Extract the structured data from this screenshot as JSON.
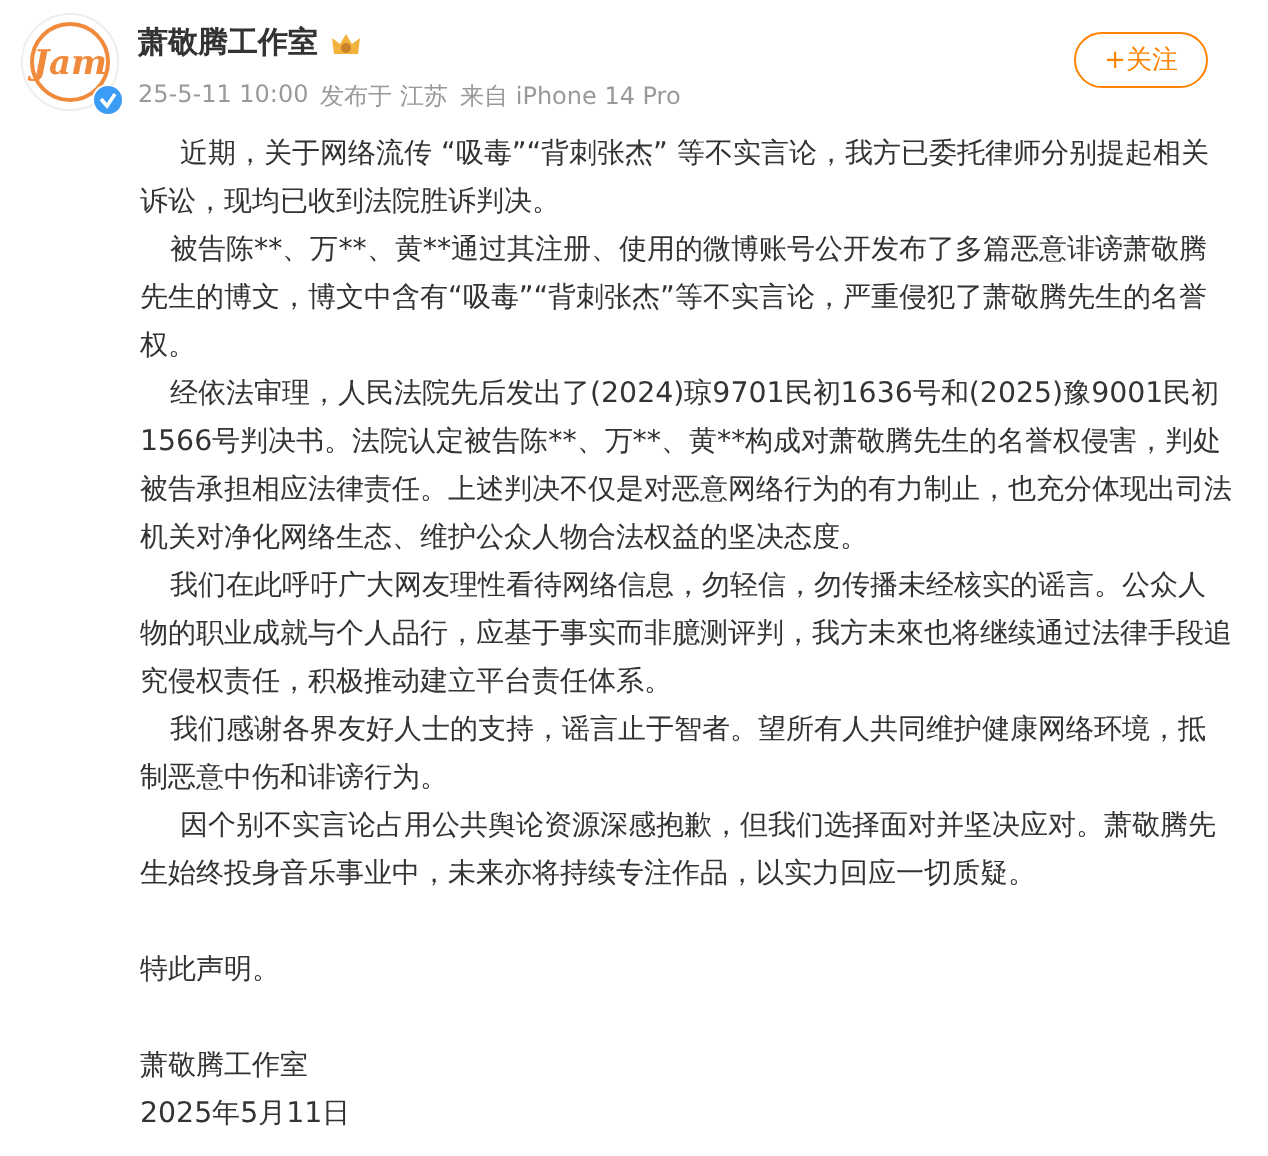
{
  "post": {
    "avatar": {
      "logo_text": "Jam",
      "verified": true
    },
    "author": "萧敬腾工作室",
    "meta": [
      "25-5-11 10:00",
      "发布于 江苏",
      "来自 iPhone 14 Pro"
    ],
    "follow_button": "+关注",
    "paragraphs": [
      {
        "kind": "indent_wide",
        "text": "近期，关于网络流传 “吸毒”“背刺张杰” 等不实言论，我方已委托律师分别提起相关诉讼，现均已收到法院胜诉判决。"
      },
      {
        "kind": "indent",
        "text": "被告陈**、万**、黄**通过其注册、使用的微博账号公开发布了多篇恶意诽谤萧敬腾先生的博文，博文中含有“吸毒”“背刺张杰”等不实言论，严重侵犯了萧敬腾先生的名誉权。"
      },
      {
        "kind": "indent",
        "text": "经依法审理，人民法院先后发出了(2024)琼9701民初1636号和(2025)豫9001民初1566号判决书。法院认定被告陈**、万**、黄**构成对萧敬腾先生的名誉权侵害，判处被告承担相应法律责任。上述判决不仅是对恶意网络行为的有力制止，也充分体现出司法机关对净化网络生态、维护公众人物合法权益的坚决态度。"
      },
      {
        "kind": "indent",
        "text": "我们在此呼吁广大网友理性看待网络信息，勿轻信，勿传播未经核实的谣言。公众人物的职业成就与个人品行，应基于事实而非臆测评判，我方未來也将继续通过法律手段追究侵权责任，积极推动建立平台责任体系。"
      },
      {
        "kind": "indent",
        "text": "我们感谢各界友好人士的支持，谣言止于智者。望所有人共同维护健康网络环境，抵制恶意中伤和诽谤行为。"
      },
      {
        "kind": "indent_wide",
        "text": "因个别不实言论占用公共舆论资源深感抱歉，但我们选择面对并坚决应对。萧敬腾先生始终投身音乐事业中，未来亦将持续专注作品，以实力回应一切质疑。"
      },
      {
        "kind": "gap"
      },
      {
        "kind": "plain",
        "text": "特此声明。"
      },
      {
        "kind": "gap"
      },
      {
        "kind": "plain",
        "text": "萧敬腾工作室"
      },
      {
        "kind": "plain",
        "text": "2025年5月11日"
      }
    ]
  }
}
